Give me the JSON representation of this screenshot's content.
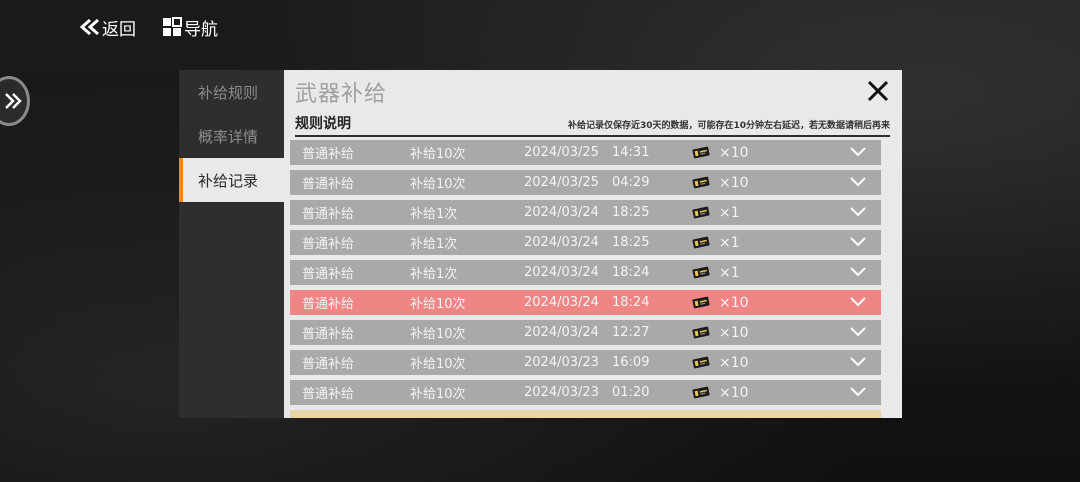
{
  "top_bar": {
    "back_label": "返回",
    "nav_label": "导航"
  },
  "tabs": [
    {
      "label": "补给规则",
      "active": false
    },
    {
      "label": "概率详情",
      "active": false
    },
    {
      "label": "补给记录",
      "active": true
    }
  ],
  "panel": {
    "title": "武器补给",
    "section_title": "规则说明",
    "note": "补给记录仅保存近30天的数据，可能存在10分钟左右延迟，若无数据请稍后再来"
  },
  "colors": {
    "accent": "#f08a1c",
    "highlight_row": "#ef8585",
    "row": "#a9a9a9",
    "gold_row": "#ead5a6"
  },
  "records": [
    {
      "type": "普通补给",
      "count": "补给10次",
      "date": "2024/03/25",
      "time": "14:31",
      "qty": "×10",
      "highlight": false
    },
    {
      "type": "普通补给",
      "count": "补给10次",
      "date": "2024/03/25",
      "time": "04:29",
      "qty": "×10",
      "highlight": false
    },
    {
      "type": "普通补给",
      "count": "补给1次",
      "date": "2024/03/24",
      "time": "18:25",
      "qty": "×1",
      "highlight": false
    },
    {
      "type": "普通补给",
      "count": "补给1次",
      "date": "2024/03/24",
      "time": "18:25",
      "qty": "×1",
      "highlight": false
    },
    {
      "type": "普通补给",
      "count": "补给1次",
      "date": "2024/03/24",
      "time": "18:24",
      "qty": "×1",
      "highlight": false
    },
    {
      "type": "普通补给",
      "count": "补给10次",
      "date": "2024/03/24",
      "time": "18:24",
      "qty": "×10",
      "highlight": true
    },
    {
      "type": "普通补给",
      "count": "补给10次",
      "date": "2024/03/24",
      "time": "12:27",
      "qty": "×10",
      "highlight": false
    },
    {
      "type": "普通补给",
      "count": "补给10次",
      "date": "2024/03/23",
      "time": "16:09",
      "qty": "×10",
      "highlight": false
    },
    {
      "type": "普通补给",
      "count": "补给10次",
      "date": "2024/03/23",
      "time": "01:20",
      "qty": "×10",
      "highlight": false
    }
  ]
}
